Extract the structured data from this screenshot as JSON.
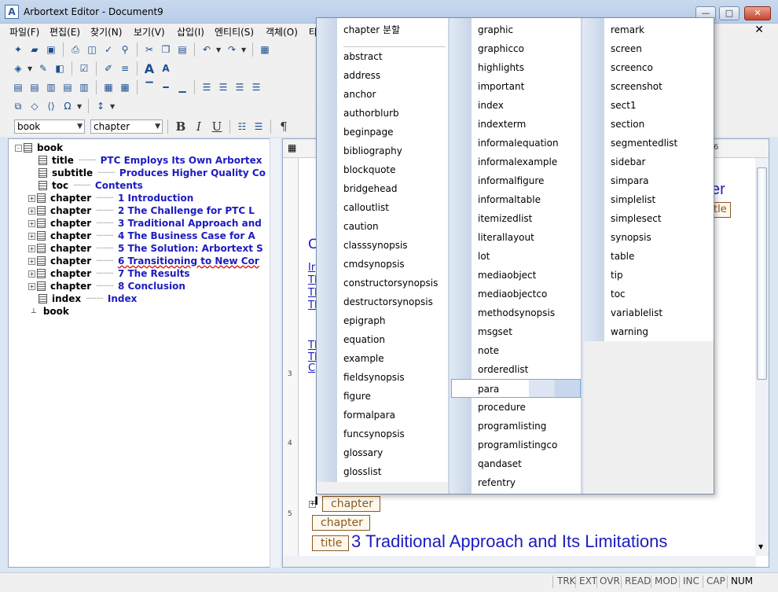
{
  "window": {
    "title": "Arbortext Editor - Document9",
    "icon_letter": "A",
    "minimize": "—",
    "maximize": "□",
    "close": "✕",
    "doc_close": "✕"
  },
  "menu": [
    "파일(F)",
    "편집(E)",
    "찾기(N)",
    "보기(V)",
    "삽입(I)",
    "엔티티(S)",
    "객체(O)",
    "타"
  ],
  "toolbar": {
    "style_combo": "book",
    "element_combo": "chapter",
    "bold": "B",
    "italic": "I",
    "underline": "U",
    "pilcrow": "¶",
    "omega": "Ω"
  },
  "tree": [
    {
      "depth": 0,
      "expander": "-",
      "element": "book",
      "value": ""
    },
    {
      "depth": 1,
      "expander": "",
      "element": "title",
      "value": "PTC Employs Its Own Arbortex"
    },
    {
      "depth": 1,
      "expander": "",
      "element": "subtitle",
      "value": "Produces Higher Quality Co"
    },
    {
      "depth": 1,
      "expander": "",
      "element": "toc",
      "value": "Contents"
    },
    {
      "depth": 1,
      "expander": "+",
      "element": "chapter",
      "value": "1 Introduction"
    },
    {
      "depth": 1,
      "expander": "+",
      "element": "chapter",
      "value": "2 The Challenge for PTC L"
    },
    {
      "depth": 1,
      "expander": "+",
      "element": "chapter",
      "value": "3 Traditional Approach and"
    },
    {
      "depth": 1,
      "expander": "+",
      "element": "chapter",
      "value": "4 The Business Case for A"
    },
    {
      "depth": 1,
      "expander": "+",
      "element": "chapter",
      "value": "5 The Solution: Arbortext S"
    },
    {
      "depth": 1,
      "expander": "+",
      "element": "chapter",
      "value": "6 Transitioning to New Cor"
    },
    {
      "depth": 1,
      "expander": "+",
      "element": "chapter",
      "value": "7 The Results"
    },
    {
      "depth": 1,
      "expander": "+",
      "element": "chapter",
      "value": "8 Conclusion"
    },
    {
      "depth": 1,
      "expander": "",
      "element": "index",
      "value": "Index"
    },
    {
      "depth": 0,
      "expander": "",
      "element": "book",
      "value": ""
    }
  ],
  "document": {
    "heading_fragment": "er",
    "title_tag_fragment": "tle",
    "chapter_tag_1": "chapter",
    "chapter_tag_2": "chapter",
    "title_tag": "title",
    "chapter_heading": "3 Traditional Approach and Its Limitations",
    "frag_c": "C",
    "link_frags": [
      "Ir",
      "Tl",
      "Tl",
      "Tl",
      "Tl",
      "Tl",
      "C"
    ],
    "ruler_nums": [
      "3",
      "4",
      "5"
    ],
    "ruler_top_frag": "6"
  },
  "popup": {
    "col1": [
      "chapter 분할",
      "abstract",
      "address",
      "anchor",
      "authorblurb",
      "beginpage",
      "bibliography",
      "blockquote",
      "bridgehead",
      "calloutlist",
      "caution",
      "classsynopsis",
      "cmdsynopsis",
      "constructorsynopsis",
      "destructorsynopsis",
      "epigraph",
      "equation",
      "example",
      "fieldsynopsis",
      "figure",
      "formalpara",
      "funcsynopsis",
      "glossary",
      "glosslist"
    ],
    "col2": [
      "graphic",
      "graphicco",
      "highlights",
      "important",
      "index",
      "indexterm",
      "informalequation",
      "informalexample",
      "informalfigure",
      "informaltable",
      "itemizedlist",
      "literallayout",
      "lot",
      "mediaobject",
      "mediaobjectco",
      "methodsynopsis",
      "msgset",
      "note",
      "orderedlist",
      "para",
      "procedure",
      "programlisting",
      "programlistingco",
      "qandaset",
      "refentry"
    ],
    "col3": [
      "remark",
      "screen",
      "screenco",
      "screenshot",
      "sect1",
      "section",
      "segmentedlist",
      "sidebar",
      "simpara",
      "simplelist",
      "simplesect",
      "synopsis",
      "table",
      "tip",
      "toc",
      "variablelist",
      "warning"
    ],
    "highlighted": "para"
  },
  "status": [
    "TRK",
    "EXT",
    "OVR",
    "READ",
    "MOD",
    "INC",
    "CAP",
    "NUM"
  ]
}
